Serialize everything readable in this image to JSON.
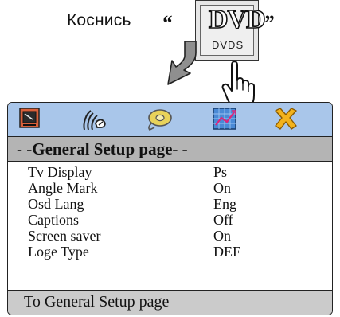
{
  "instruction": {
    "text": "Коснись",
    "quote_open": "“",
    "quote_close": "”",
    "button_logo": "DVD",
    "button_sublabel": "DVDS",
    "pointer_icon": "hand-pointer-icon",
    "arrow_icon": "down-arrow-icon"
  },
  "menu": {
    "tabs": [
      {
        "icon": "tv-display-icon",
        "color": "#d8603a"
      },
      {
        "icon": "audio-speaker-icon",
        "color": "#222222"
      },
      {
        "icon": "disc-icon",
        "color": "#e8d25a"
      },
      {
        "icon": "preference-chart-icon",
        "color": "#2f7ac8"
      },
      {
        "icon": "exit-x-icon",
        "color": "#f2b21c"
      }
    ],
    "title": "- -General Setup page- -",
    "items": [
      {
        "label": "Tv Display",
        "value": "Ps"
      },
      {
        "label": "Angle Mark",
        "value": "On"
      },
      {
        "label": "Osd Lang",
        "value": "Eng"
      },
      {
        "label": "Captions",
        "value": "Off"
      },
      {
        "label": "Screen saver",
        "value": "On"
      },
      {
        "label": "Loge Type",
        "value": "DEF"
      }
    ],
    "footer": "To General Setup page"
  },
  "colors": {
    "tabbar_bg": "#a9c6ea",
    "title_bg": "#b4b4b4",
    "footer_bg": "#cbcbcb",
    "arrow_fill": "#8f8f8f"
  }
}
